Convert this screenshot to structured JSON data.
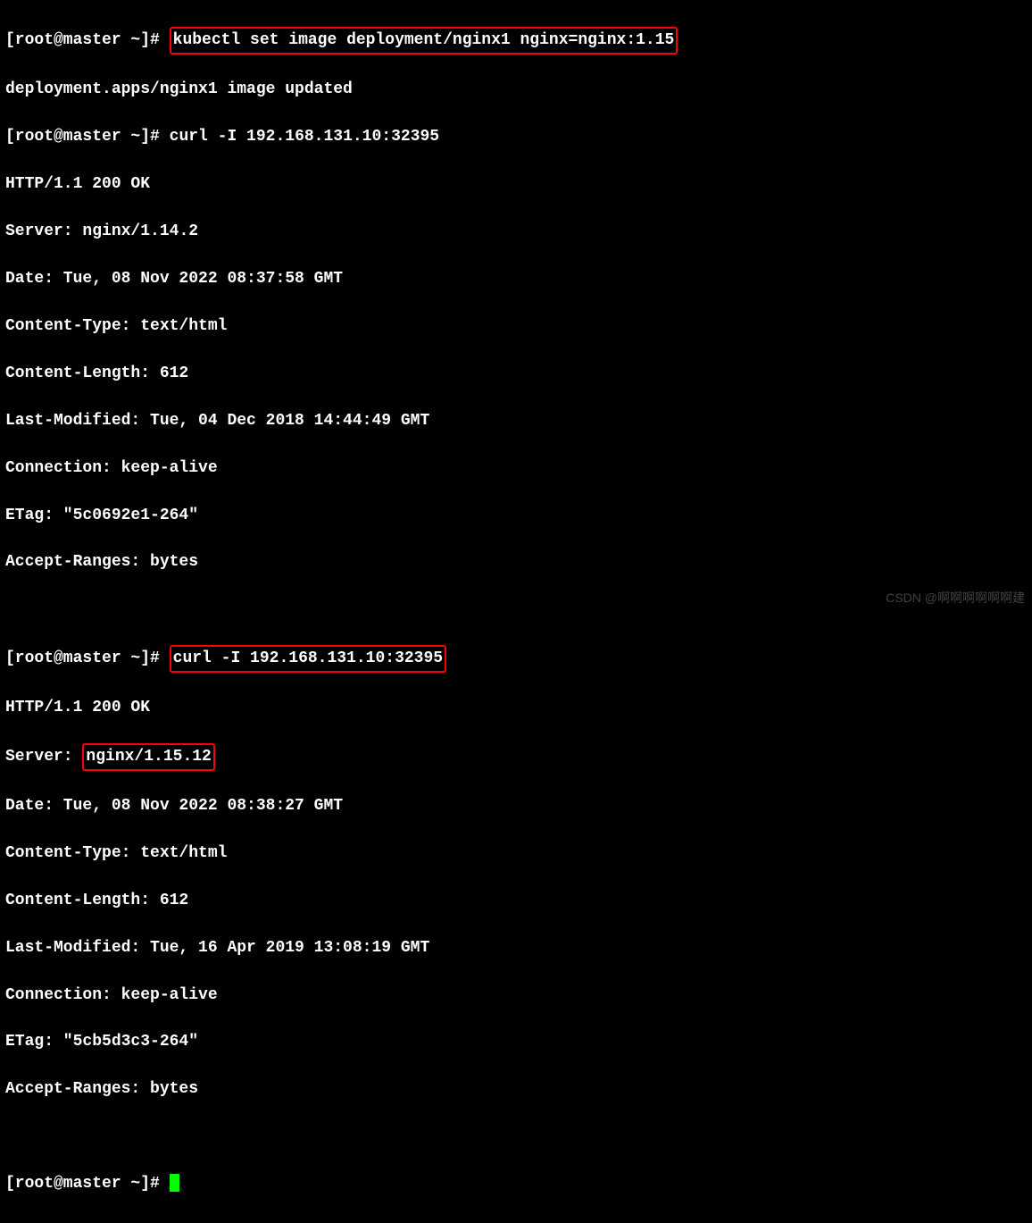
{
  "prompt": "[root@master ~]# ",
  "cmd1": "kubectl set image deployment/nginx1 nginx=nginx:1.15",
  "out1": "deployment.apps/nginx1 image updated",
  "cmd2": "curl -I 192.168.131.10:32395",
  "resp1": {
    "status": "HTTP/1.1 200 OK",
    "server_label": "Server: ",
    "server_value": "nginx/1.14.2",
    "date": "Date: Tue, 08 Nov 2022 08:37:58 GMT",
    "ctype": "Content-Type: text/html",
    "clen": "Content-Length: 612",
    "lastmod": "Last-Modified: Tue, 04 Dec 2018 14:44:49 GMT",
    "conn": "Connection: keep-alive",
    "etag": "ETag: \"5c0692e1-264\"",
    "accept": "Accept-Ranges: bytes"
  },
  "cmd3": "curl -I 192.168.131.10:32395",
  "resp2": {
    "status": "HTTP/1.1 200 OK",
    "server_label": "Server: ",
    "server_value": "nginx/1.15.12",
    "date": "Date: Tue, 08 Nov 2022 08:38:27 GMT",
    "ctype": "Content-Type: text/html",
    "clen": "Content-Length: 612",
    "lastmod": "Last-Modified: Tue, 16 Apr 2019 13:08:19 GMT",
    "conn": "Connection: keep-alive",
    "etag": "ETag: \"5cb5d3c3-264\"",
    "accept": "Accept-Ranges: bytes"
  },
  "watermark": "CSDN @啊啊啊啊啊啊建"
}
